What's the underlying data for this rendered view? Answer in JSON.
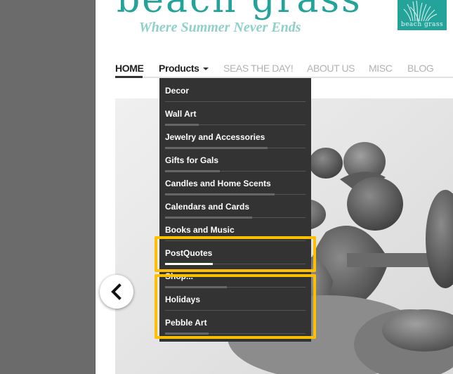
{
  "brand": {
    "title": "beach grass",
    "tagline": "Where Summer Never Ends",
    "logo_text": "beach grass"
  },
  "nav": {
    "items": [
      {
        "label": "HOME",
        "state": "active"
      },
      {
        "label": "Products",
        "state": "open"
      },
      {
        "label": "SEAS THE DAY!",
        "state": "normal"
      },
      {
        "label": "ABOUT US",
        "state": "normal"
      },
      {
        "label": "MISC",
        "state": "normal"
      },
      {
        "label": "BLOG",
        "state": "normal"
      }
    ]
  },
  "dropdown": {
    "items": [
      {
        "label": "Decor",
        "progress": 0.0,
        "highlighted": false
      },
      {
        "label": "Wall Art",
        "progress": 0.24,
        "highlighted": false
      },
      {
        "label": "Jewelry and Accessories",
        "progress": 0.73,
        "highlighted": false
      },
      {
        "label": "Gifts for Gals",
        "progress": 0.39,
        "highlighted": false
      },
      {
        "label": "Candles and Home Scents",
        "progress": 0.78,
        "highlighted": false
      },
      {
        "label": "Calendars and Cards",
        "progress": 0.62,
        "highlighted": false
      },
      {
        "label": "Books and Music",
        "progress": 0.0,
        "highlighted": false
      },
      {
        "label": "PostQuotes",
        "progress": 0.34,
        "highlighted": true
      },
      {
        "label": "Shop...",
        "progress": 0.44,
        "highlighted": false
      },
      {
        "label": "Holidays",
        "progress": 0.0,
        "highlighted": false
      },
      {
        "label": "Pebble Art",
        "progress": 0.31,
        "highlighted": false
      }
    ]
  },
  "colors": {
    "brand_teal": "#23a39a",
    "tagline_teal": "#8fd0c9",
    "menu_bg": "#333333",
    "highlight_outline": "#ffc000"
  },
  "icons": {
    "prev": "chevron-left-icon",
    "caret": "caret-down-icon",
    "logo": "grass-logo-icon"
  }
}
